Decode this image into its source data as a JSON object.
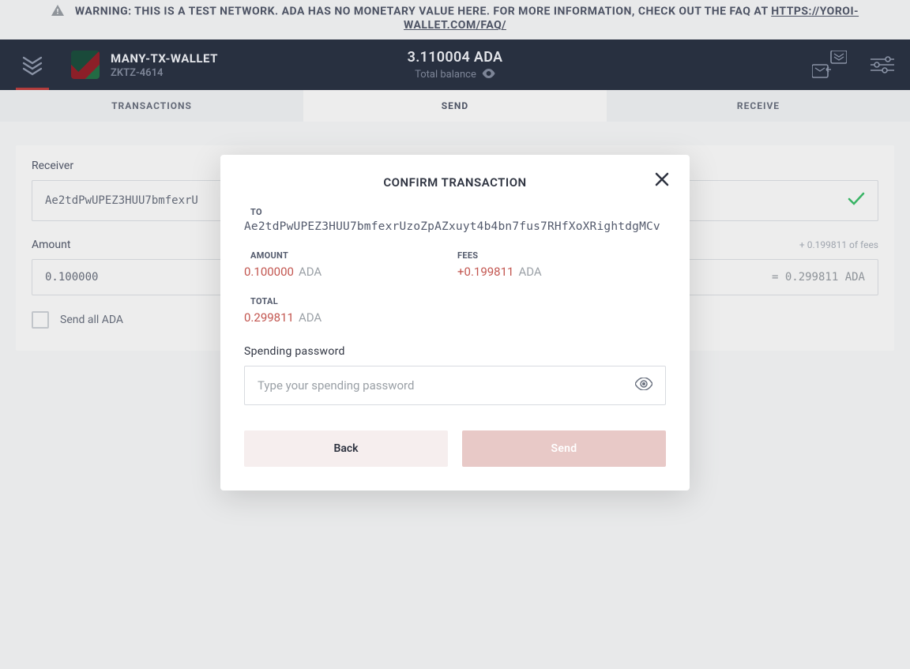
{
  "warning": {
    "text_prefix": "WARNING: THIS IS A TEST NETWORK. ADA HAS NO MONETARY VALUE HERE. FOR MORE INFORMATION, CHECK OUT THE FAQ AT ",
    "link_text": "HTTPS://YOROI-WALLET.COM/FAQ/"
  },
  "header": {
    "wallet_name": "MANY-TX-WALLET",
    "wallet_id": "ZKTZ-4614",
    "balance_value": "3.110004 ADA",
    "balance_label": "Total balance"
  },
  "tabs": {
    "transactions": "TRANSACTIONS",
    "send": "SEND",
    "receive": "RECEIVE"
  },
  "send_form": {
    "receiver_label": "Receiver",
    "receiver_value": "Ae2tdPwUPEZ3HUU7bmfexrU",
    "amount_label": "Amount",
    "amount_value": "0.100000",
    "fees_hint": "+ 0.199811 of fees",
    "total_hint": "= 0.299811 ADA",
    "send_all_label": "Send all ADA"
  },
  "modal": {
    "title": "CONFIRM TRANSACTION",
    "to_label": "TO",
    "to_value": "Ae2tdPwUPEZ3HUU7bmfexrUzoZpAZxuyt4b4bn7fus7RHfXoXRightdgMCv",
    "amount_label": "AMOUNT",
    "amount_value": "0.100000",
    "amount_unit": "ADA",
    "fees_label": "FEES",
    "fees_value": "+0.199811",
    "fees_unit": "ADA",
    "total_label": "TOTAL",
    "total_value": "0.299811",
    "total_unit": "ADA",
    "password_label": "Spending password",
    "password_placeholder": "Type your spending password",
    "back_label": "Back",
    "send_label": "Send"
  }
}
